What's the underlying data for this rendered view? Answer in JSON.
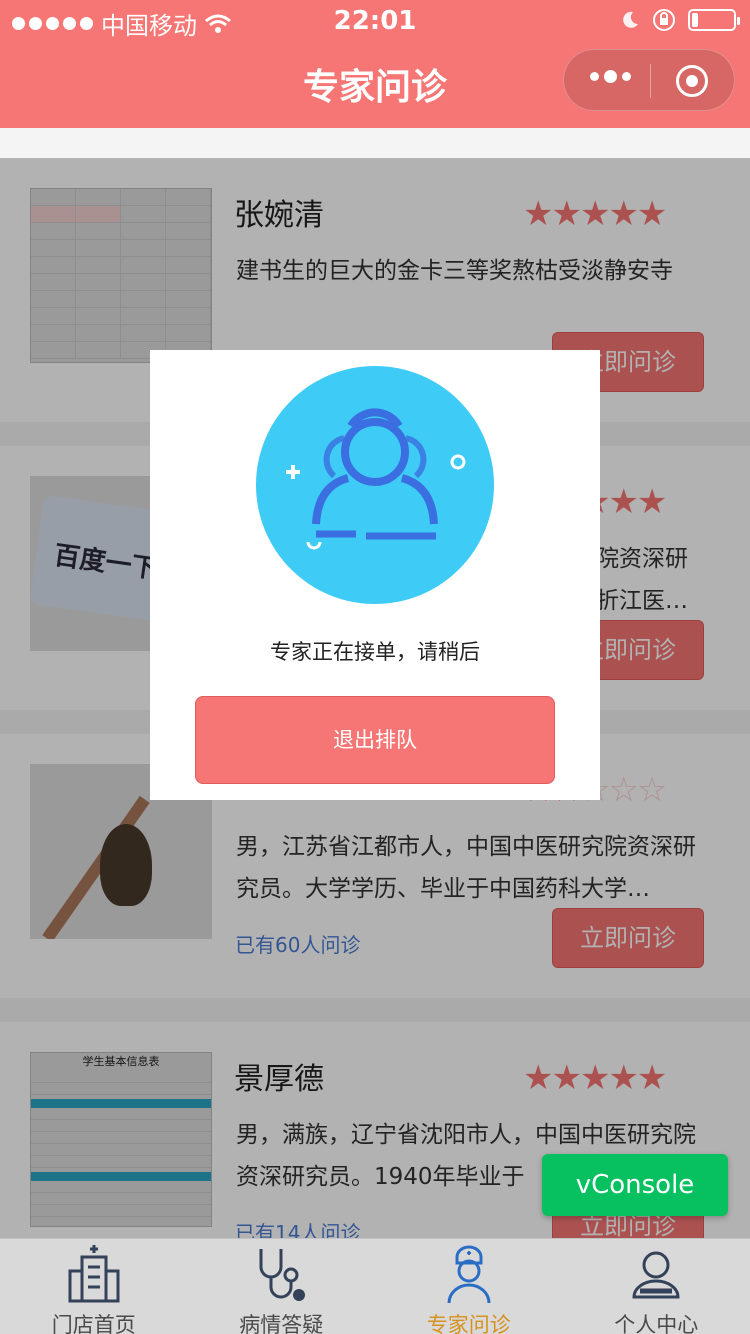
{
  "status": {
    "carrier": "中国移动",
    "time": "22:01"
  },
  "nav": {
    "title": "专家问诊"
  },
  "experts": [
    {
      "name": "张婉清",
      "rating": 5,
      "description": "建书生的巨大的金卡三等奖熬枯受淡静安寺",
      "count": "",
      "button": "立即问诊",
      "thumb": "table-document"
    },
    {
      "name": "",
      "rating": 5,
      "description": "院资深研\n折江医…",
      "count": "",
      "button": "立即问诊",
      "thumb": "sign-photo",
      "thumb_text": "百度一下"
    },
    {
      "name": "",
      "rating": 2,
      "description": "男，江苏省江都市人，中国中医研究院资深研究员。大学学历、毕业于中国药科大学…",
      "count": "已有60人问诊",
      "button": "立即问诊",
      "thumb": "bird-photo"
    },
    {
      "name": "景厚德",
      "rating": 5,
      "description": "男，满族，辽宁省沈阳市人，中国中医研究院资深研究员。1940年毕业于",
      "count": "已有14人问诊",
      "button": "立即问诊",
      "thumb": "form-document",
      "thumb_text": "学生基本信息表"
    }
  ],
  "modal": {
    "avatar_icon": "expert-group-icon",
    "message": "专家正在接单，请稍后",
    "exit_label": "退出排队"
  },
  "vconsole": {
    "label": "vConsole"
  },
  "tabbar": {
    "items": [
      {
        "label": "门店首页",
        "icon": "hospital-icon",
        "active": false
      },
      {
        "label": "病情答疑",
        "icon": "stethoscope-icon",
        "active": false
      },
      {
        "label": "专家问诊",
        "icon": "doctor-icon",
        "active": true
      },
      {
        "label": "个人中心",
        "icon": "user-icon",
        "active": false
      }
    ]
  },
  "colors": {
    "accent": "#f57674",
    "link": "#4b7bd3",
    "active_tab": "#f5a623",
    "avatar_bg": "#3ecbf5",
    "vconsole": "#07c160"
  }
}
